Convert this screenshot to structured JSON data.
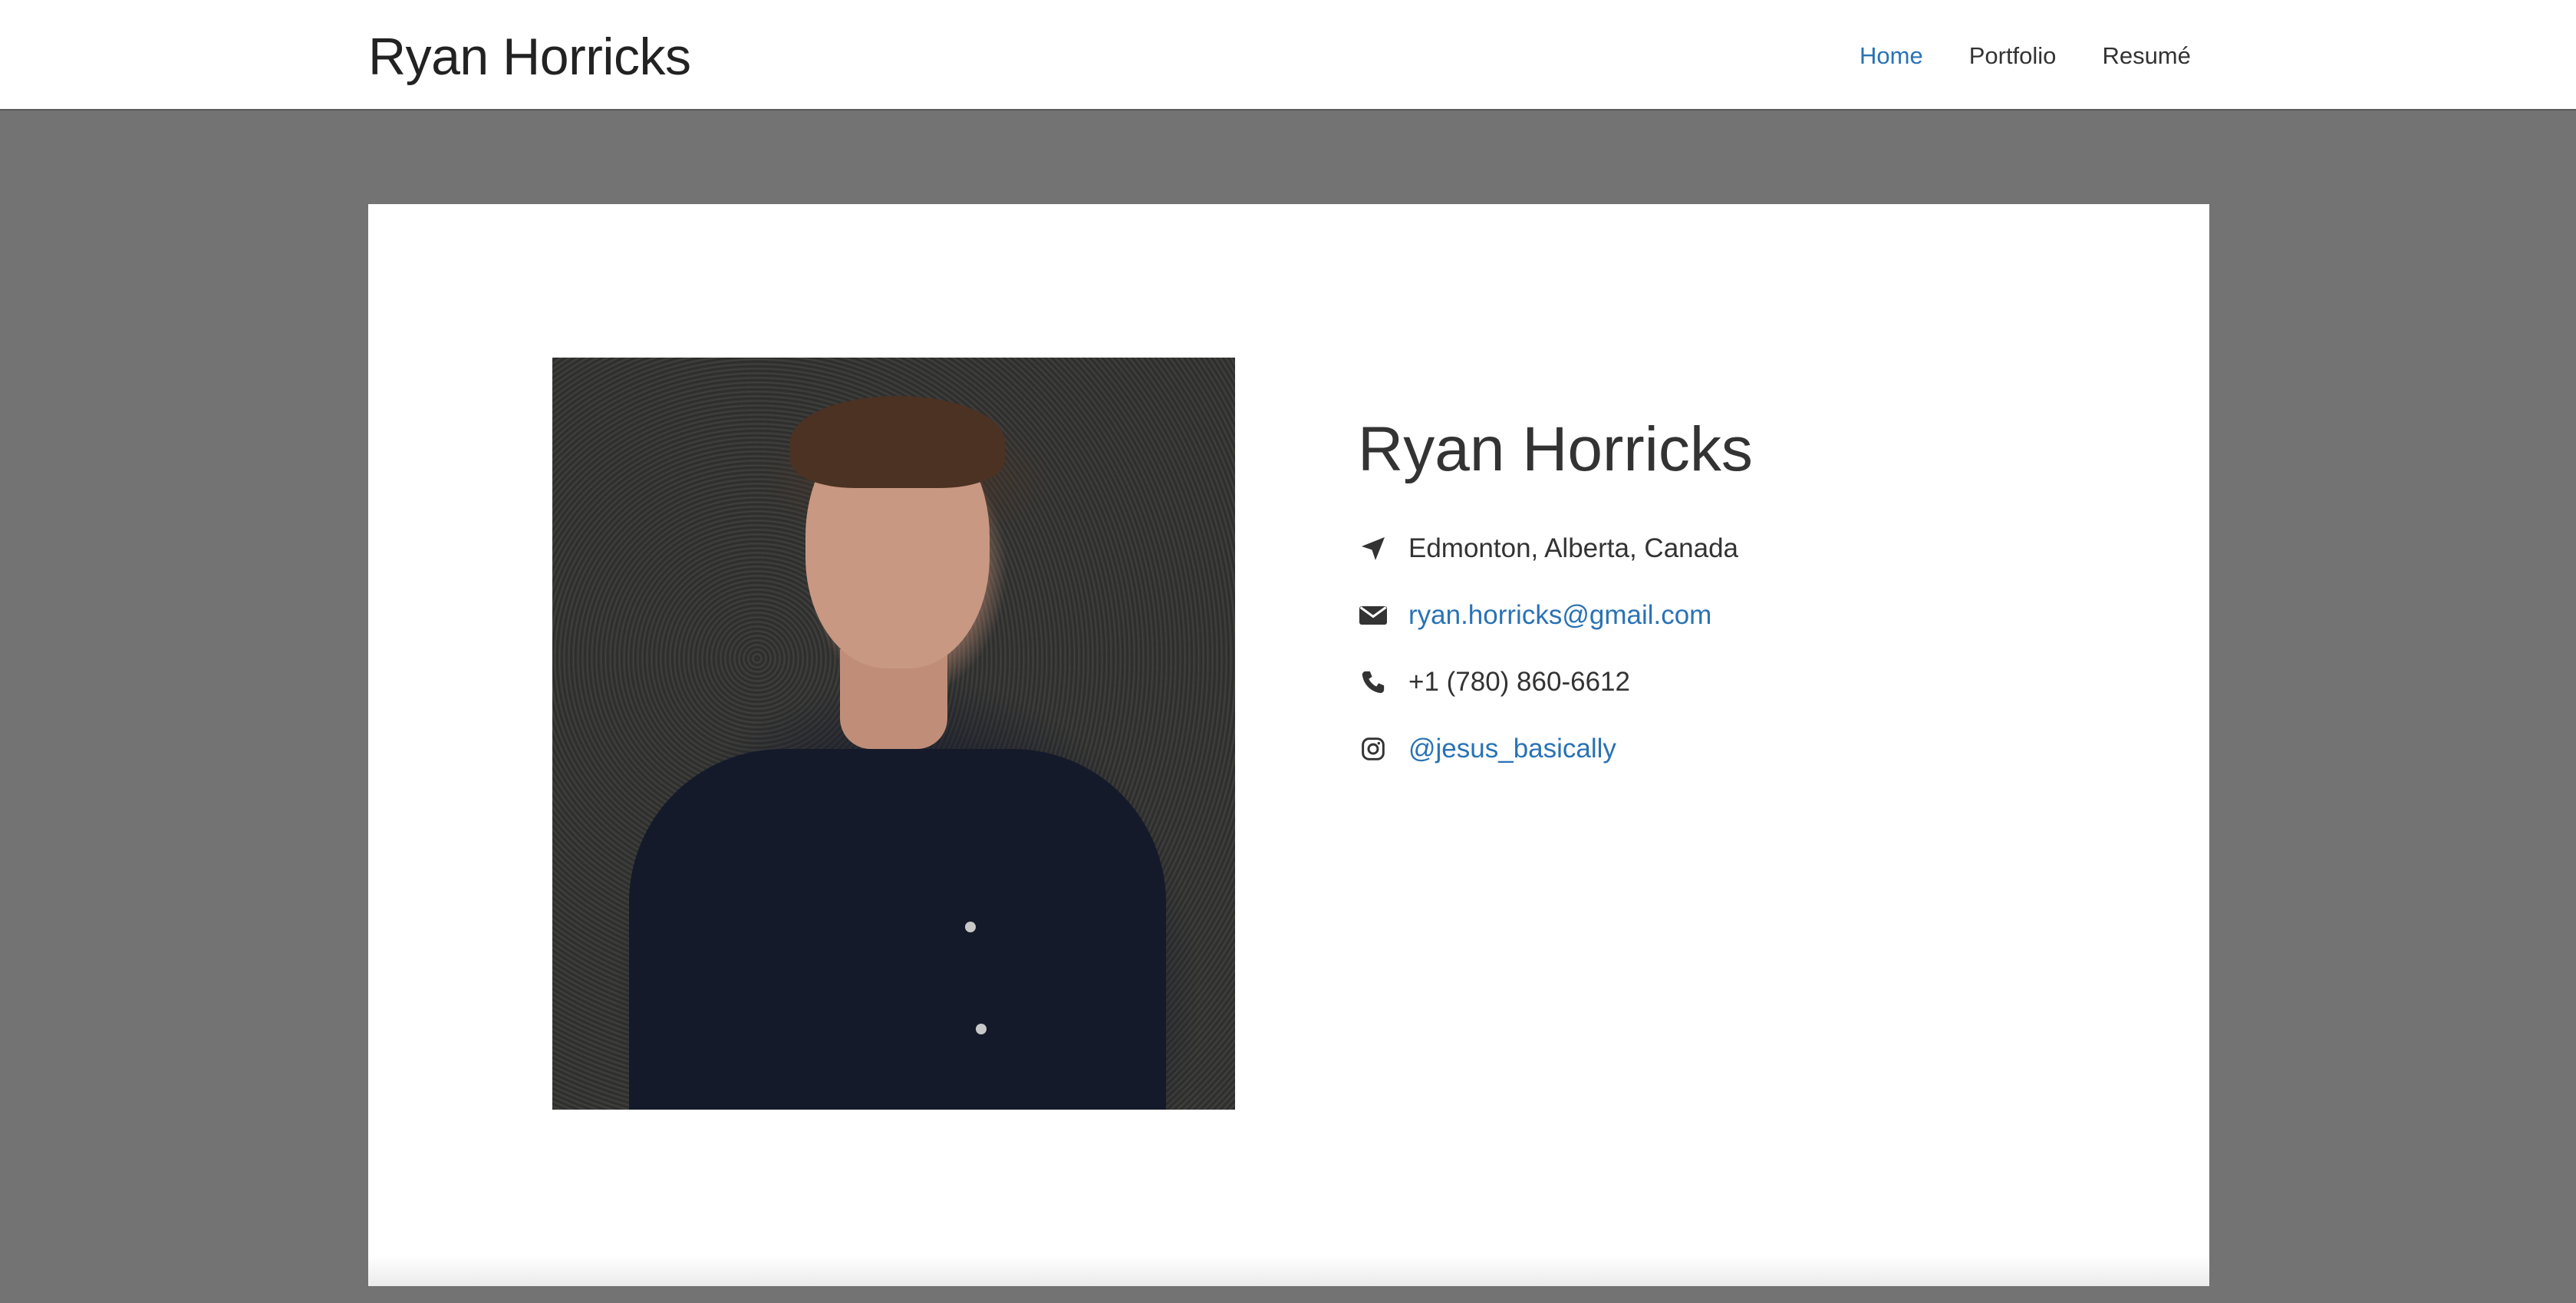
{
  "header": {
    "site_title": "Ryan Horricks",
    "nav": [
      {
        "label": "Home",
        "active": true
      },
      {
        "label": "Portfolio",
        "active": false
      },
      {
        "label": "Resumé",
        "active": false
      }
    ]
  },
  "profile": {
    "name": "Ryan Horricks",
    "location": "Edmonton, Alberta, Canada",
    "email": "ryan.horricks@gmail.com",
    "phone": "+1 (780) 860-6612",
    "instagram": "@jesus_basically",
    "photo_alt": "Portrait of Ryan Horricks"
  },
  "icons": {
    "location": "location-arrow-icon",
    "email": "envelope-icon",
    "phone": "phone-icon",
    "instagram": "instagram-icon"
  },
  "colors": {
    "accent": "#2a72b5",
    "text": "#333333",
    "page_background": "#737373",
    "card_background": "#ffffff"
  }
}
